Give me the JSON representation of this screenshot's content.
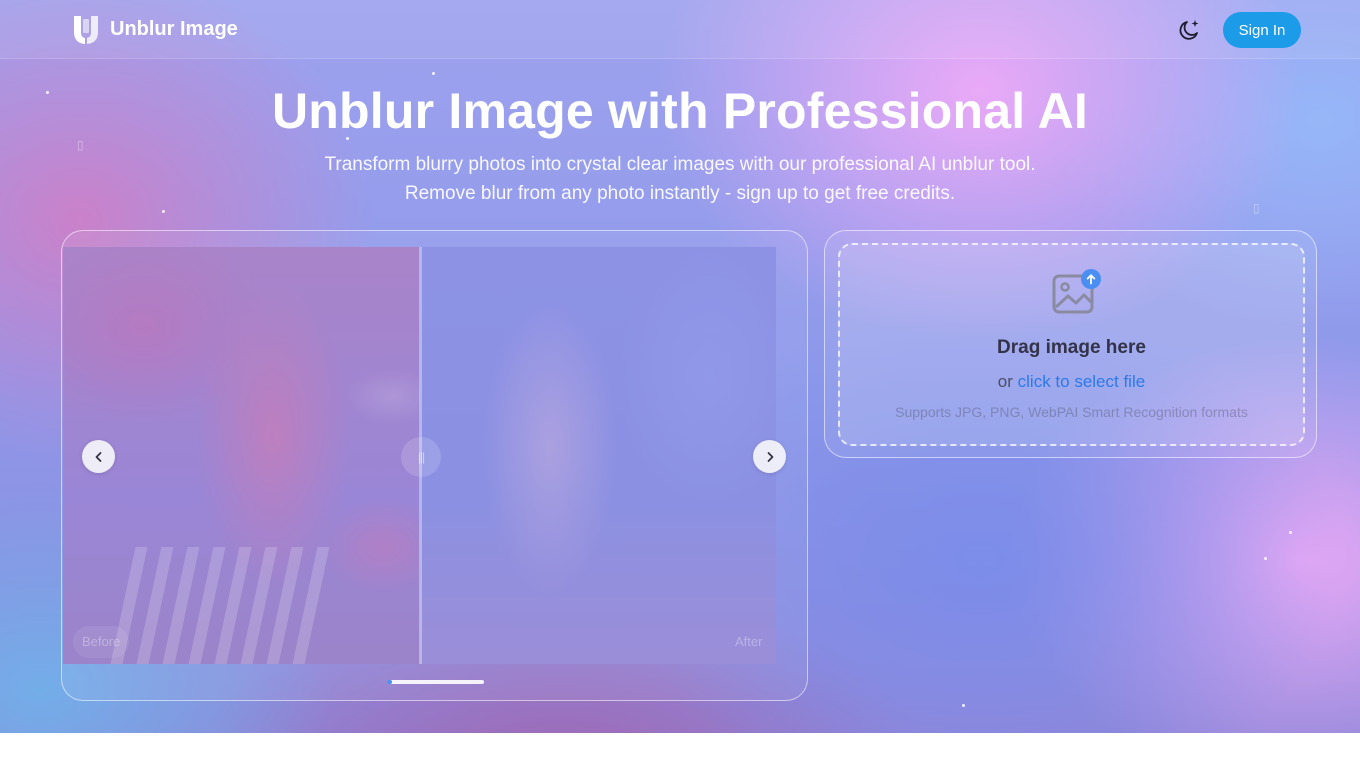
{
  "header": {
    "brand": "Unblur Image",
    "logo_icon": "u-logo-icon",
    "theme_icon": "moon-sparkle-icon",
    "signin_label": "Sign In"
  },
  "hero": {
    "title_mark": "",
    "title": "Unblur Image with Professional AI",
    "subtitle_lines": [
      "Transform blurry photos into crystal clear images with our professional AI unblur tool.",
      "Remove blur from any photo instantly - sign up to get free credits."
    ]
  },
  "comparison": {
    "before_label": "Before",
    "after_label": "After",
    "prev_icon": "chevron-left-icon",
    "next_icon": "chevron-right-icon",
    "slider_handle_glyph": "|||",
    "slider_position": 0.5,
    "carousel_progress": 0.05
  },
  "upload": {
    "icon": "image-upload-icon",
    "title": "Drag image here",
    "or_text": "or ",
    "link_text": "click to select file",
    "formats_text": "Supports JPG, PNG, WebPAI Smart Recognition formats"
  },
  "colors": {
    "signin_bg": "#1b9be8",
    "link": "#2b7ae8",
    "progress": "#4b8ef0",
    "upload_badge": "#4a8ef2"
  }
}
